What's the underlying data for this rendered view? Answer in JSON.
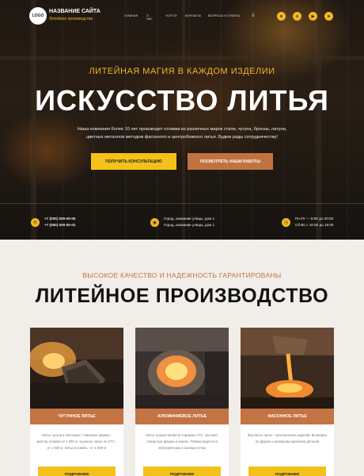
{
  "header": {
    "logo_text": "LOGO",
    "site_name": "НАЗВАНИЕ САЙТА",
    "site_tagline": "Литейное производство",
    "nav": [
      "Главная",
      "О нас",
      "Услуги",
      "Контакты",
      "Вопросы и ответы"
    ],
    "socials": [
      "vk-icon",
      "odnoklassniki-icon",
      "youtube-icon",
      "telegram-icon"
    ]
  },
  "hero": {
    "kicker": "ЛИТЕЙНАЯ МАГИЯ В КАЖДОМ ИЗДЕЛИИ",
    "title": "ИСКУССТВО ЛИТЬЯ",
    "text": "Наша компания более 10 лет производит отливки из различных марок стали, чугуна, бронзы, латуни, цветных металлов методом фасонного и центробежного литья. Будем рады сотрудничеству!",
    "button_primary": "Получить консультацию",
    "button_secondary": "Посмотреть наши работы"
  },
  "contacts": {
    "phone_1": "+7 (000) 000-00-00",
    "phone_2": "+7 (000) 000-00-01",
    "address_1": "Город, название улицы, дом 1",
    "address_2": "Город, название улицы, дом 1",
    "hours_1": "Пн-Пт — 9:00 до 20:00",
    "hours_2": "Сб-Вс с 10:00 до 18:00"
  },
  "production": {
    "kicker": "ВЫСОКОЕ КАЧЕСТВО И НАДЕЖНОСТЬ ГАРАНТИРОВАНЫ",
    "title": "ЛИТЕЙНОЕ ПРОИЗВОДСТВО",
    "cards": [
      {
        "title": "Чугунное литье",
        "desc": "Литье чугуна в песчаные / глиняные формы - мастер отливки от 1 000 кг, чугунное литье по ХТС - от 1 000 кг, литье в кокиль - от 1 500 кг",
        "button": "Подробнее"
      },
      {
        "title": "Алюминиевое литье",
        "desc": "Литье осуществляется в формы ХТС, песчано-глинистые формы и кокиль. Плавка ведется в электрических и газовых печах",
        "button": "Подробнее"
      },
      {
        "title": "Фасонное литье",
        "desc": "Фасонное литье - изготовление изделий. Возможно по форме и размерам заказчика деталей",
        "button": "Подробнее"
      }
    ]
  },
  "colors": {
    "accent_yellow": "#f3c11a",
    "accent_copper": "#c47343",
    "background": "#f1eeea"
  }
}
